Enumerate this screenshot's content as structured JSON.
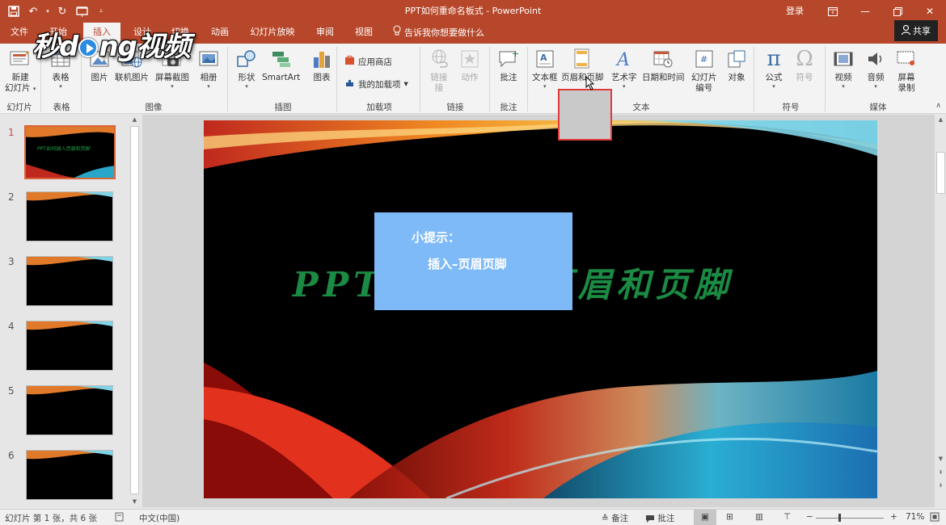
{
  "window": {
    "title": "PPT如何重命名板式 - PowerPoint",
    "login": "登录"
  },
  "watermark": {
    "text_pre": "秒d",
    "text_post": "ng视频"
  },
  "tabs": [
    "文件",
    "开始",
    "插入",
    "设计",
    "切换",
    "动画",
    "幻灯片放映",
    "审阅",
    "视图"
  ],
  "tell_me": "告诉我你想要做什么",
  "share": "共享",
  "ribbon": {
    "new_slide": "新建",
    "new_slide_2": "幻灯片",
    "table": "表格",
    "picture": "图片",
    "online_picture": "联机图片",
    "screenshot": "屏幕截图",
    "album": "相册",
    "shape": "形状",
    "smartart": "SmartArt",
    "chart": "图表",
    "store": "应用商店",
    "my_addins": "我的加载项",
    "link": "链接",
    "link_2": "接",
    "action": "动作",
    "comment": "批注",
    "textbox": "文本框",
    "header_footer": "页眉和页脚",
    "wordart": "艺术字",
    "datetime": "日期和时间",
    "slide_number": "幻灯片",
    "slide_number_2": "编号",
    "object": "对象",
    "equation": "公式",
    "symbol": "符号",
    "video": "视频",
    "audio": "音频",
    "screen_rec": "屏幕",
    "screen_rec_2": "录制",
    "groups": {
      "slides": "幻灯片",
      "tables": "表格",
      "images": "图像",
      "illustrations": "插图",
      "addins": "加载项",
      "links": "链接",
      "comments": "批注",
      "text": "文本",
      "symbols": "符号",
      "media": "媒体"
    }
  },
  "thumbnails": {
    "numbers": [
      "1",
      "2",
      "3",
      "4",
      "5",
      "6"
    ],
    "first_title": "PPT如何插入页眉和页脚"
  },
  "slide": {
    "title": "PPT如何插入页眉和页脚",
    "tip_head": "小提示：",
    "tip_body": "插入–页眉页脚"
  },
  "status": {
    "slide_info": "幻灯片 第 1 张，共 6 张",
    "language": "中文(中国)",
    "notes": "备注",
    "comments": "批注",
    "zoom": "71%"
  },
  "colors": {
    "accent": "#b7472a",
    "title_green": "#1b8a43",
    "tip_blue": "#7fbaf8",
    "highlight_red": "#e03b3b"
  }
}
